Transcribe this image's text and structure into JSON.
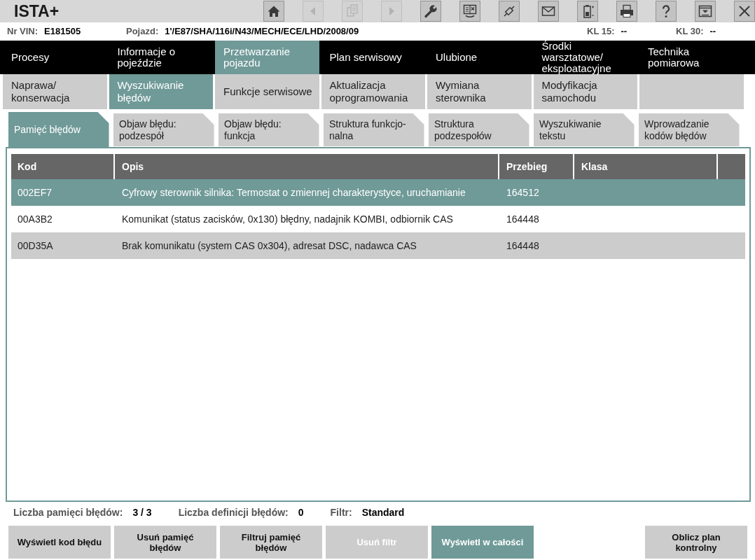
{
  "app": {
    "title": "ISTA+"
  },
  "toolbar": [
    {
      "kind": "home",
      "disabled": false
    },
    {
      "kind": "back",
      "disabled": true
    },
    {
      "kind": "documents",
      "disabled": true
    },
    {
      "kind": "forward",
      "disabled": true
    },
    {
      "kind": "wrench",
      "disabled": false
    },
    {
      "kind": "screens",
      "disabled": false
    },
    {
      "kind": "plug",
      "disabled": false
    },
    {
      "kind": "envelope",
      "disabled": false
    },
    {
      "kind": "battery",
      "disabled": false
    },
    {
      "kind": "printer",
      "disabled": false
    },
    {
      "kind": "help",
      "disabled": false
    },
    {
      "kind": "list",
      "disabled": false
    },
    {
      "kind": "close",
      "disabled": false
    }
  ],
  "vehicle_info": [
    {
      "label": "Nr VIN:",
      "value": "E181505"
    },
    {
      "label": "Pojazd:",
      "value": "1'/E87/SHA/116i/N43/MECH/ECE/LHD/2008/09"
    },
    {
      "label": "KL 15:",
      "value": "--"
    },
    {
      "label": "KL 30:",
      "value": "--"
    }
  ],
  "main_nav": [
    {
      "label": "Procesy",
      "selected": false
    },
    {
      "label": "Informacje o pojeździe",
      "selected": false
    },
    {
      "label": "Przetwarzanie pojazdu",
      "selected": true
    },
    {
      "label": "Plan serwisowy",
      "selected": false
    },
    {
      "label": "Ulubione",
      "selected": false
    },
    {
      "label": "Środki warsztatowe/ eksploatacyjne",
      "selected": false
    },
    {
      "label": "Technika pomiarowa",
      "selected": false
    }
  ],
  "sub_nav": [
    {
      "label": "Naprawa/ konserwacja",
      "selected": false
    },
    {
      "label": "Wyszukiwanie błędów",
      "selected": true
    },
    {
      "label": "Funkcje serwisowe",
      "selected": false
    },
    {
      "label": "Aktualizacja oprogramowania",
      "selected": false
    },
    {
      "label": "Wymiana sterownika",
      "selected": false
    },
    {
      "label": "Modyfikacja samochodu",
      "selected": false
    }
  ],
  "tabs": [
    {
      "label": "Pamięć błędów",
      "selected": true
    },
    {
      "label": "Objaw błędu: podzespół",
      "selected": false
    },
    {
      "label": "Objaw błędu: funkcja",
      "selected": false
    },
    {
      "label": "Struktura funkcjo-nalna",
      "selected": false
    },
    {
      "label": "Struktura podzespołów",
      "selected": false
    },
    {
      "label": "Wyszukiwanie tekstu",
      "selected": false
    },
    {
      "label": "Wprowadzanie kodów błędów",
      "selected": false
    }
  ],
  "fault_table": {
    "columns": [
      "Kod",
      "Opis",
      "Przebieg",
      "Klasa"
    ],
    "rows": [
      {
        "cells": [
          "002EF7",
          "Cyfrowy sterownik silnika: Termostat o zmiennej charakterystyce, uruchamianie",
          "164512"
        ],
        "selected": true
      },
      {
        "cells": [
          "00A3B2",
          "Komunikat (status zacisków, 0x130) błędny, nadajnik KOMBI, odbiornik CAS",
          "164448"
        ],
        "selected": false
      },
      {
        "cells": [
          "00D35A",
          "Brak komunikatu (system CAS 0x304), adresat DSC, nadawca CAS",
          "164448"
        ],
        "selected": false
      }
    ]
  },
  "summary": [
    {
      "label": "Liczba pamięci błędów:",
      "value": "3 / 3"
    },
    {
      "label": "Liczba definicji błędów:",
      "value": "0"
    },
    {
      "label": "Filtr:",
      "value": "Standard"
    }
  ],
  "buttons": [
    {
      "label": "Wyświetl kod błędu",
      "disabled": false,
      "selected": false
    },
    {
      "label": "Usuń pamięć błędów",
      "disabled": false,
      "selected": false
    },
    {
      "label": "Filtruj pamięć błędów",
      "disabled": false,
      "selected": false
    },
    {
      "label": "Usuń filtr",
      "disabled": true,
      "selected": false
    },
    {
      "label": "Wyświetl w całości",
      "disabled": false,
      "selected": true
    },
    {
      "label": "Oblicz plan kontrolny",
      "disabled": false,
      "selected": false
    }
  ]
}
